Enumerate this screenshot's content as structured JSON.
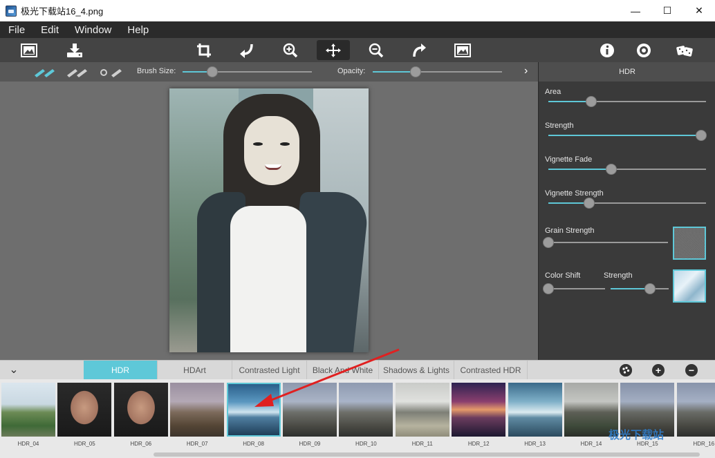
{
  "window": {
    "title": "极光下载站16_4.png",
    "minimize": "—",
    "maximize": "☐",
    "close": "✕"
  },
  "menu": [
    "File",
    "Edit",
    "Window",
    "Help"
  ],
  "toolbar": {
    "icons": [
      "open-image-icon",
      "save-icon",
      "crop-icon",
      "undo-icon",
      "zoom-in-icon",
      "move-icon",
      "zoom-out-icon",
      "redo-icon",
      "fit-screen-icon",
      "info-icon",
      "settings-icon",
      "random-dice-icon"
    ]
  },
  "brushbar": {
    "brush_size_label": "Brush Size:",
    "brush_size_value": 0.23,
    "opacity_label": "Opacity:",
    "opacity_value": 0.33,
    "expand": "›"
  },
  "panel": {
    "title": "HDR",
    "sliders": [
      {
        "label": "Area",
        "value": 0.27
      },
      {
        "label": "Strength",
        "value": 0.97
      },
      {
        "label": "Vignette Fade",
        "value": 0.4
      },
      {
        "label": "Vignette Strength",
        "value": 0.26
      },
      {
        "label": "Grain Strength",
        "value": 0.0
      },
      {
        "label": "Color Shift",
        "value": 0.0
      },
      {
        "label": "Strength",
        "value": 0.68
      }
    ]
  },
  "tabs": {
    "collapse": "⌄",
    "items": [
      "HDR",
      "HDArt",
      "Contrasted Light",
      "Black And White",
      "Shadows & Lights",
      "Contrasted HDR"
    ],
    "active": "HDR"
  },
  "thumbnails": [
    "HDR_04",
    "HDR_05",
    "HDR_06",
    "HDR_07",
    "HDR_08",
    "HDR_09",
    "HDR_10",
    "HDR_11",
    "HDR_12",
    "HDR_13",
    "HDR_14",
    "HDR_15",
    "HDR_16"
  ],
  "active_thumbnail": "HDR_08",
  "watermark": "极光下载站",
  "colors": {
    "accent": "#5ec8d8",
    "annotation_arrow": "#e02020"
  }
}
